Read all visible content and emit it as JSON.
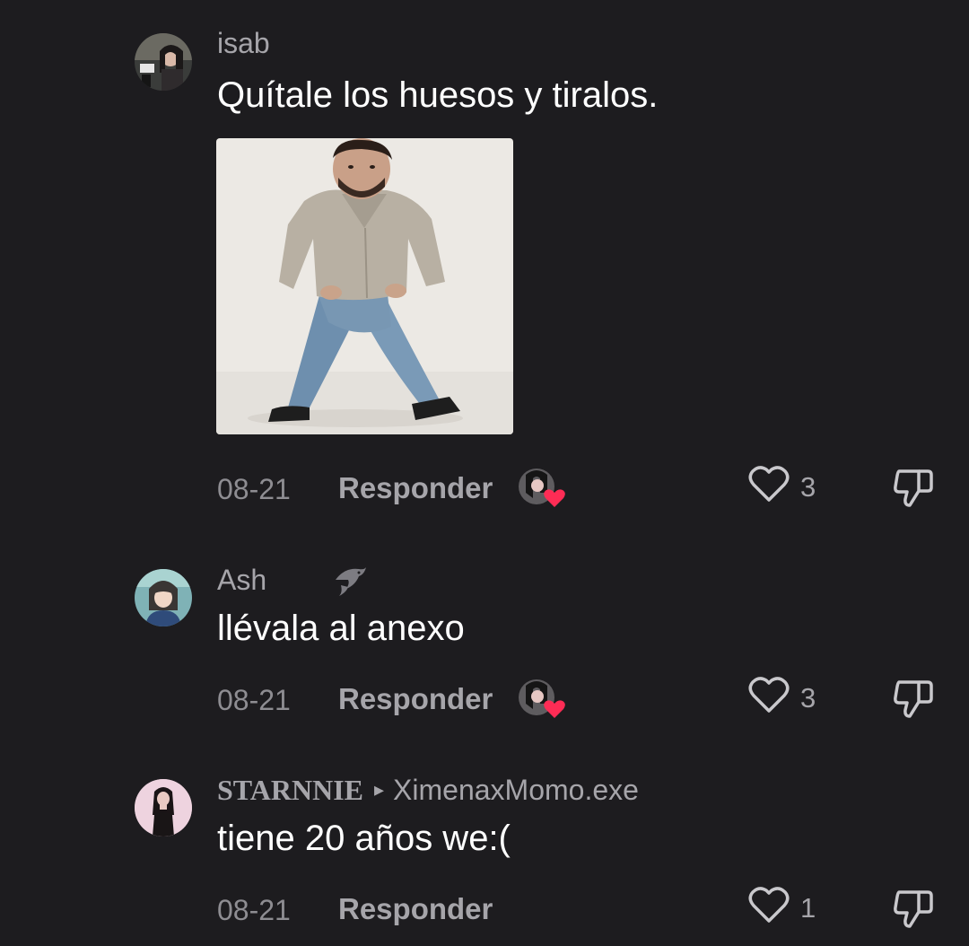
{
  "comments": [
    {
      "username": "isab",
      "text": "Quítale los huesos y tiralos.",
      "has_image": true,
      "date": "08-21",
      "reply_label": "Responder",
      "likes": "3",
      "creator_liked": true
    },
    {
      "username": "Ash",
      "badge_icon": "dolphin-icon",
      "text": "llévala al anexo",
      "date": "08-21",
      "reply_label": "Responder",
      "likes": "3",
      "creator_liked": true
    },
    {
      "username": "STARNNIE",
      "reply_to": "XimenaxMomo.exe",
      "text": "tiene 20 años we:(",
      "date": "08-21",
      "reply_label": "Responder",
      "likes": "1",
      "creator_liked": false
    }
  ],
  "colors": {
    "background": "#1d1c1f",
    "text": "#ffffff",
    "muted": "#a6a5aa",
    "heart": "#fe2c55"
  }
}
